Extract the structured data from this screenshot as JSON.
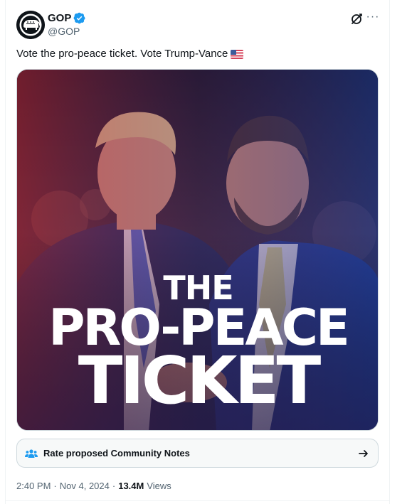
{
  "account": {
    "display_name": "GOP",
    "handle": "@GOP",
    "verified": true,
    "avatar_icon": "elephant-logo-icon"
  },
  "header_actions": {
    "grok_icon": "grok-icon",
    "more_label": "···"
  },
  "tweet": {
    "text": "Vote the pro-peace ticket. Vote Trump-Vance",
    "emoji": "us-flag-emoji"
  },
  "media": {
    "overlay_lines": [
      "THE",
      "PRO-PEACE",
      "TICKET"
    ]
  },
  "community_notes": {
    "label": "Rate proposed Community Notes",
    "icon": "people-icon",
    "arrow_icon": "arrow-right-icon"
  },
  "meta": {
    "time": "2:40 PM",
    "separator": "·",
    "date": "Nov 4, 2024",
    "views_count": "13.4M",
    "views_label": "Views"
  },
  "colors": {
    "verified_blue": "#1d9bf0",
    "secondary_text": "#536471",
    "primary_text": "#0f1419",
    "border": "#cfd9de"
  }
}
